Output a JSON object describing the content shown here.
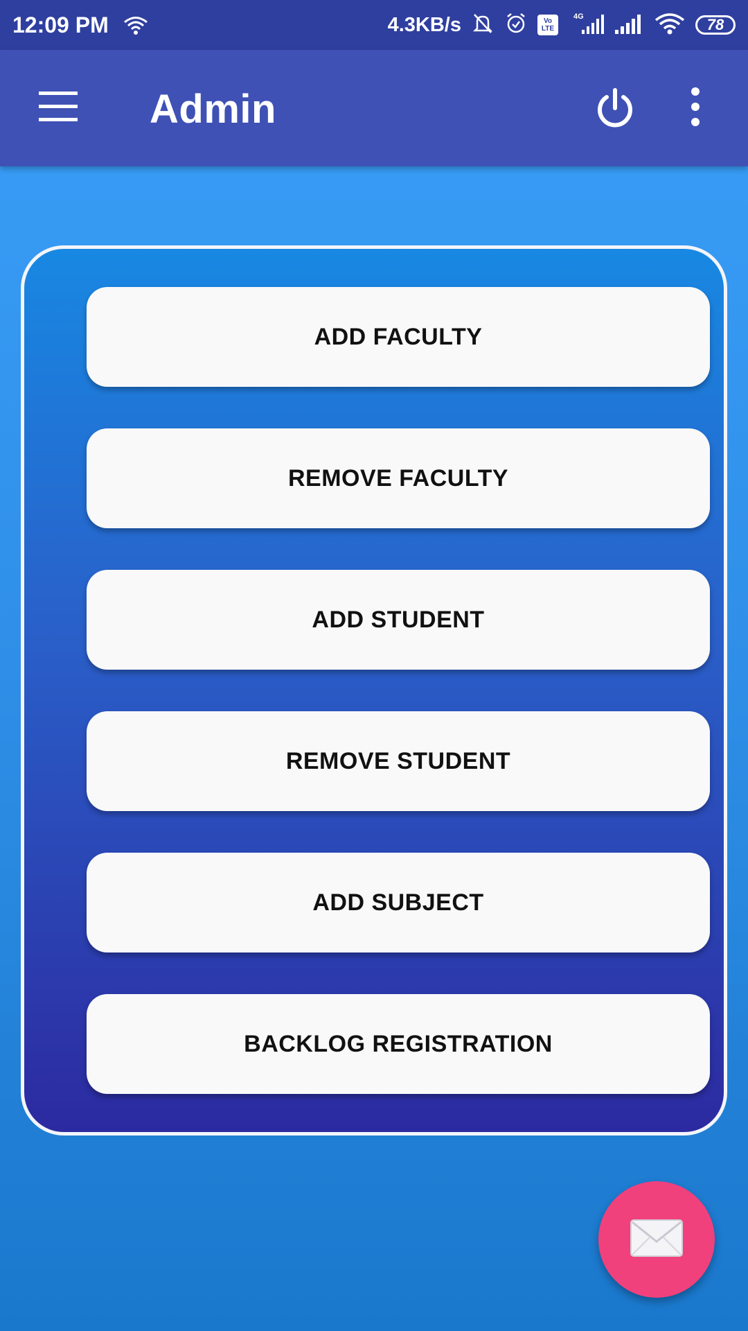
{
  "status_bar": {
    "time": "12:09 PM",
    "network_speed": "4.3KB/s",
    "battery_level": "78",
    "volte_top": "Vo",
    "volte_bottom": "LTE",
    "network_type": "4G"
  },
  "app_bar": {
    "title": "Admin",
    "menu_icon": "hamburger-menu-icon",
    "power_icon": "power-icon",
    "overflow_icon": "more-vert-icon"
  },
  "actions": [
    {
      "label": "ADD FACULTY"
    },
    {
      "label": "REMOVE FACULTY"
    },
    {
      "label": "ADD STUDENT"
    },
    {
      "label": "REMOVE STUDENT"
    },
    {
      "label": "ADD SUBJECT"
    },
    {
      "label": "BACKLOG REGISTRATION"
    }
  ],
  "fab": {
    "icon": "mail-icon"
  },
  "colors": {
    "status_bar": "#2f3f9f",
    "app_bar": "#3f51b5",
    "fab": "#f0417c",
    "button_bg": "#f9f9f9"
  }
}
